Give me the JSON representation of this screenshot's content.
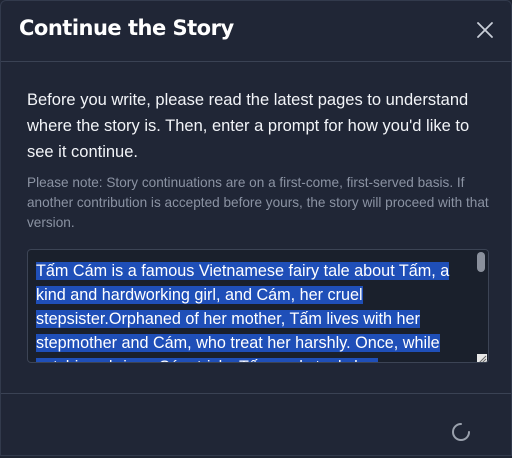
{
  "dialog": {
    "title": "Continue the Story",
    "close_icon": "close-icon",
    "intro": "Before you write, please read the latest pages to understand where the story is. Then, enter a prompt for how you'd like to see it continue.",
    "note": "Please note: Story continuations are on a first-come, first-served basis. If another contribution is accepted before yours, the story will proceed with that version.",
    "story_text": "Tấm Cám is a famous Vietnamese fairy tale about Tấm, a kind and hardworking girl, and Cám, her cruel stepsister.Orphaned of her mother, Tấm lives with her stepmother and Cám, who treat her harshly. Once, while catching shrimp, Cám tricks Tấm and steals her",
    "loading_icon": "loading-spinner-icon"
  }
}
